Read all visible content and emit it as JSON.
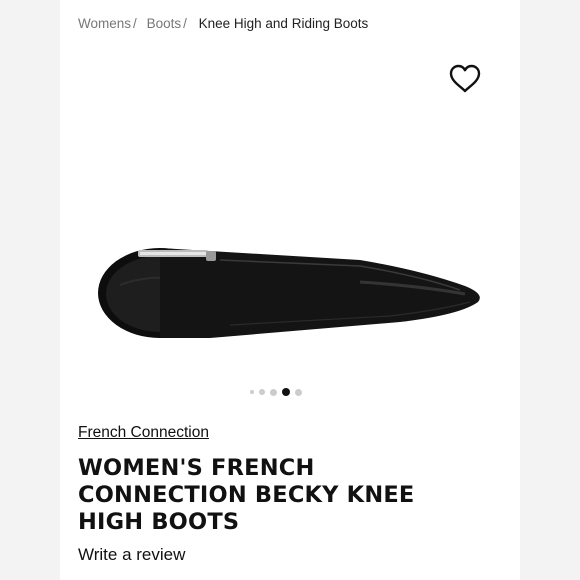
{
  "breadcrumb": {
    "items": [
      "Womens",
      "Boots"
    ],
    "separator": "/",
    "current": "Knee High and Riding Boots"
  },
  "wishlist": {
    "icon": "heart-icon"
  },
  "gallery": {
    "image": "black knee-high leather boot",
    "slide_count": 5,
    "active_index": 3
  },
  "product": {
    "brand": "French Connection",
    "title": "WOMEN'S FRENCH CONNECTION BECKY KNEE HIGH BOOTS",
    "review_link": "Write a review"
  },
  "colors": {
    "text": "#111111",
    "muted": "#777777",
    "dot_active": "#111111",
    "dot_inactive": "#cccccc"
  }
}
